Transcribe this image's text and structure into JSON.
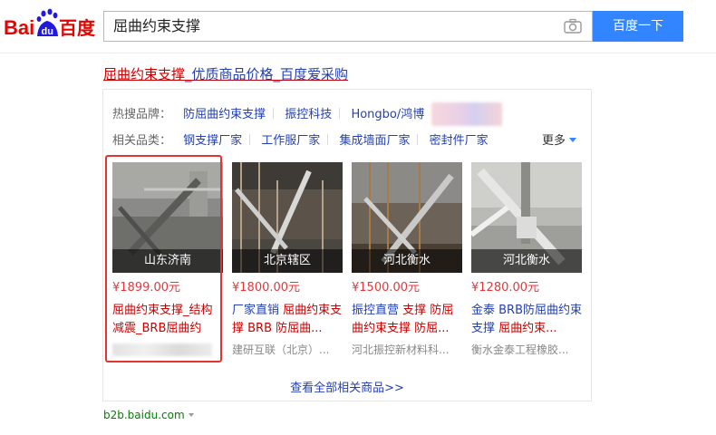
{
  "header": {
    "logo_text_left": "Bai",
    "logo_text_du": "du",
    "logo_text_cn": "百度",
    "search_value": "屈曲约束支撑",
    "search_button": "百度一下"
  },
  "result": {
    "title_highlight": "屈曲约束支撑",
    "title_rest": "_优质商品价格_百度爱采购",
    "hot_brands_label": "热搜品牌：",
    "hot_brands": [
      "防屈曲约束支撑",
      "振控科技",
      "Hongbo/鸿博"
    ],
    "related_label": "相关品类：",
    "related": [
      "钢支撑厂家",
      "工作服厂家",
      "集成墙面厂家",
      "密封件厂家"
    ],
    "more_label": "更多",
    "products": [
      {
        "location": "山东济南",
        "price": "¥1899.00元",
        "title_a": "屈曲约束支撑",
        "title_b": "_结构减震_BRB屈曲约",
        "seller": ""
      },
      {
        "location": "北京辖区",
        "price": "¥1800.00元",
        "title_a": "厂家直销 ",
        "title_b": "屈曲约束支撑 BRB 防屈曲...",
        "seller": "建研互联（北京）..."
      },
      {
        "location": "河北衡水",
        "price": "¥1500.00元",
        "title_a": "振控直营 ",
        "title_b": "支撑 防屈曲约束支撑 防屈...",
        "seller": "河北振控新材料科..."
      },
      {
        "location": "河北衡水",
        "price": "¥1280.00元",
        "title_a": "金泰 BRB防屈曲约束支撑 ",
        "title_b": "屈曲约束...",
        "seller": "衡水金泰工程橡胶..."
      }
    ],
    "view_all": "查看全部相关商品>>",
    "url": "b2b.baidu.com"
  },
  "colors": {
    "link": "#2440b3",
    "highlight": "#cc0000",
    "price": "#e4393c",
    "button": "#3385ff",
    "url": "#008000"
  }
}
